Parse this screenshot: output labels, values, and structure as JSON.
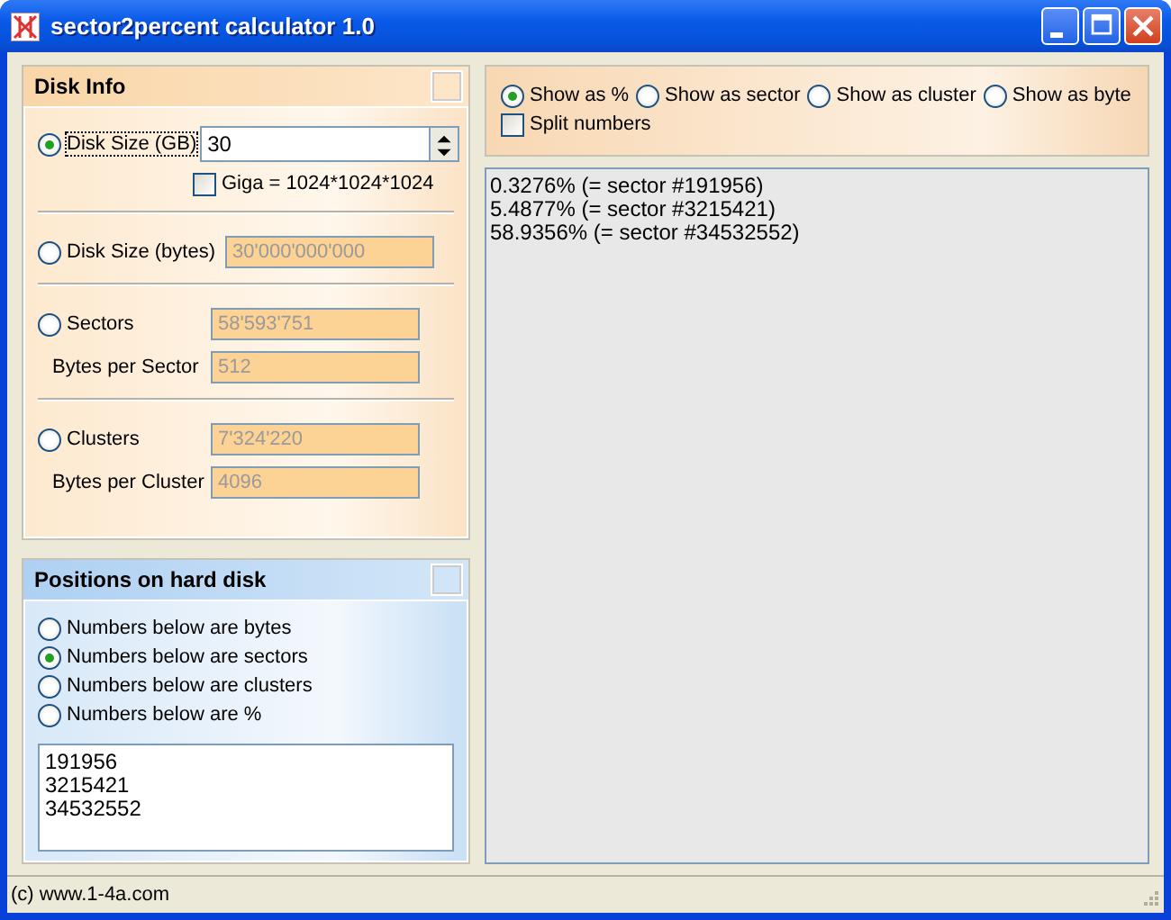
{
  "window": {
    "title": "sector2percent calculator 1.0"
  },
  "disk_info": {
    "title": "Disk Info",
    "size_gb": {
      "label": "Disk Size (GB)",
      "selected": true,
      "value": "30",
      "disabled": false
    },
    "giga": {
      "label": "Giga = 1024*1024*1024",
      "checked": false
    },
    "size_bytes": {
      "label": "Disk Size (bytes)",
      "selected": false,
      "value": "30'000'000'000",
      "disabled": true
    },
    "sectors": {
      "label": "Sectors",
      "selected": false,
      "value": "58'593'751",
      "disabled": true
    },
    "bytes_per_sector": {
      "label": "Bytes per Sector",
      "value": "512",
      "disabled": true
    },
    "clusters": {
      "label": "Clusters",
      "selected": false,
      "value": "7'324'220",
      "disabled": true
    },
    "bytes_per_cluster": {
      "label": "Bytes per Cluster",
      "value": "4096",
      "disabled": true
    }
  },
  "positions": {
    "title": "Positions on hard disk",
    "options": [
      {
        "label": "Numbers below are bytes",
        "selected": false
      },
      {
        "label": "Numbers below are sectors",
        "selected": true
      },
      {
        "label": "Numbers below are clusters",
        "selected": false
      },
      {
        "label": "Numbers below are %",
        "selected": false
      }
    ],
    "numbers": [
      "191956",
      "3215421",
      "34532552"
    ]
  },
  "display": {
    "options": [
      {
        "label": "Show as %",
        "selected": true
      },
      {
        "label": "Show as sector",
        "selected": false
      },
      {
        "label": "Show as cluster",
        "selected": false
      },
      {
        "label": "Show as byte",
        "selected": false
      }
    ],
    "split": {
      "label": "Split numbers",
      "checked": false
    }
  },
  "output": [
    "0.3276% (= sector #191956)",
    "5.4877% (= sector #3215421)",
    "58.9356% (= sector #34532552)"
  ],
  "status_bar": "(c) www.1-4a.com"
}
